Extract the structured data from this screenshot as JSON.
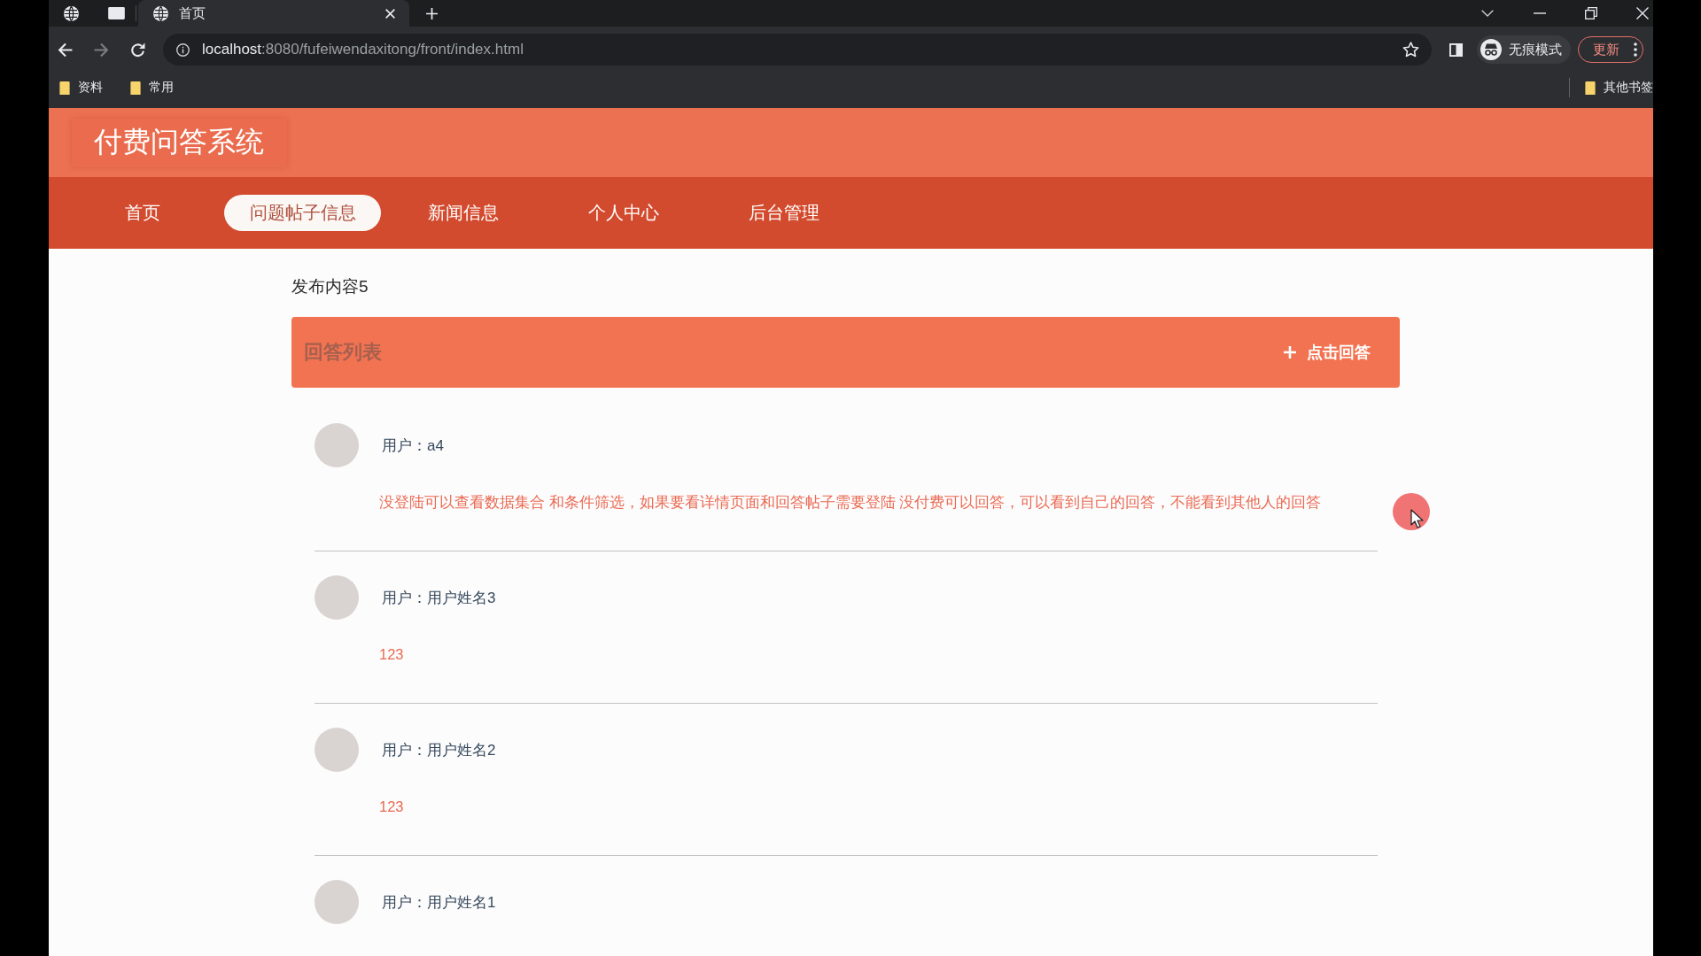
{
  "browser": {
    "tabs": [
      {
        "title": "首页",
        "selected": true
      }
    ],
    "nav_buttons": [
      {
        "kind": "back",
        "disabled": false
      },
      {
        "kind": "forward",
        "disabled": true
      },
      {
        "kind": "reload",
        "disabled": false
      }
    ],
    "address": {
      "host": "localhost",
      "path": ":8080/fufeiwendaxitong/front/index.html"
    },
    "profile": {
      "label": "无痕模式"
    },
    "update_button": {
      "label": "更新"
    },
    "bookmarks": [
      {
        "label": "资料"
      },
      {
        "label": "常用"
      }
    ],
    "other_bookmarks": {
      "label": "其他书签"
    }
  },
  "header": {
    "title": "付费问答系统"
  },
  "nav": [
    {
      "label": "首页",
      "selected": false
    },
    {
      "label": "问题帖子信息",
      "selected": true
    },
    {
      "label": "新闻信息",
      "selected": false
    },
    {
      "label": "个人中心",
      "selected": false
    },
    {
      "label": "后台管理",
      "selected": false
    }
  ],
  "post": {
    "title": "发布内容5"
  },
  "answers_panel": {
    "title": "回答列表",
    "action": "点击回答"
  },
  "answers": [
    {
      "user": "用户：a4",
      "content": "没登陆可以查看数据集合 和条件筛选，如果要看详情页面和回答帖子需要登陆 没付费可以回答，可以看到自己的回答，不能看到其他人的回答"
    },
    {
      "user": "用户：用户姓名3",
      "content": "123"
    },
    {
      "user": "用户：用户姓名2",
      "content": "123"
    },
    {
      "user": "用户：用户姓名1"
    }
  ]
}
